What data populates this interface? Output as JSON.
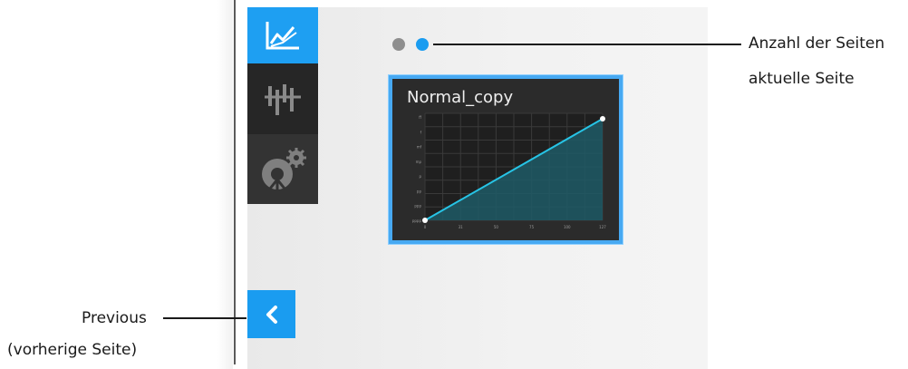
{
  "callouts": {
    "page_count": "Anzahl der Seiten",
    "current_page": "aktuelle Seite",
    "previous": "Previous",
    "previous_sub": "(vorherige Seite)"
  },
  "sidebar": {
    "items": [
      {
        "icon": "line-chart-icon",
        "active": true
      },
      {
        "icon": "waveform-icon",
        "active": false
      },
      {
        "icon": "dial-settings-icon",
        "active": false
      }
    ]
  },
  "pager": {
    "total_pages": 2,
    "current_page": 2
  },
  "card": {
    "title": "Normal_copy",
    "y_ticks": [
      "ff",
      "f",
      "mf",
      "mp",
      "p",
      "pp",
      "ppp",
      "pppp"
    ],
    "x_ticks": [
      "0",
      "31",
      "50",
      "75",
      "100",
      "127"
    ]
  },
  "colors": {
    "accent": "#1a9cf0",
    "sidebar_dark": "#262626",
    "card_bg": "#2b2b2b",
    "curve": "#27c4e6"
  }
}
